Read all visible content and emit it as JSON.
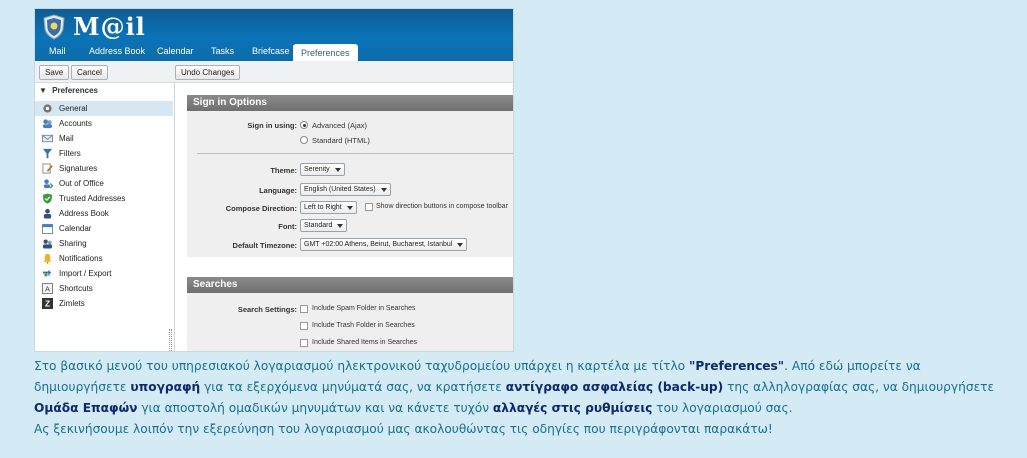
{
  "app": {
    "brand": "M@il",
    "tabs": [
      "Mail",
      "Address Book",
      "Calendar",
      "Tasks",
      "Briefcase",
      "Preferences"
    ],
    "active_tab": "Preferences"
  },
  "toolbar": {
    "save_label": "Save",
    "cancel_label": "Cancel",
    "undo_label": "Undo Changes"
  },
  "sidebar": {
    "header": "Preferences",
    "items": [
      {
        "label": "General",
        "icon": "gear-icon"
      },
      {
        "label": "Accounts",
        "icon": "accounts-icon"
      },
      {
        "label": "Mail",
        "icon": "mail-icon"
      },
      {
        "label": "Filters",
        "icon": "filter-icon"
      },
      {
        "label": "Signatures",
        "icon": "signature-icon"
      },
      {
        "label": "Out of Office",
        "icon": "out-of-office-icon"
      },
      {
        "label": "Trusted Addresses",
        "icon": "shield-check-icon"
      },
      {
        "label": "Address Book",
        "icon": "contact-icon"
      },
      {
        "label": "Calendar",
        "icon": "calendar-icon"
      },
      {
        "label": "Sharing",
        "icon": "sharing-icon"
      },
      {
        "label": "Notifications",
        "icon": "bell-icon"
      },
      {
        "label": "Import / Export",
        "icon": "import-export-icon"
      },
      {
        "label": "Shortcuts",
        "icon": "keyboard-icon"
      },
      {
        "label": "Zimlets",
        "icon": "zimlet-icon"
      }
    ]
  },
  "sign_in": {
    "title": "Sign in Options",
    "sign_in_label": "Sign in using:",
    "option_advanced": "Advanced (Ajax)",
    "option_standard": "Standard (HTML)",
    "theme_label": "Theme:",
    "theme_value": "Serenity",
    "language_label": "Language:",
    "language_value": "English (United States)",
    "compose_label": "Compose Direction:",
    "compose_value": "Left to Right",
    "compose_checkbox": "Show direction buttons in compose toolbar",
    "font_label": "Font:",
    "font_value": "Standard",
    "timezone_label": "Default Timezone:",
    "timezone_value": "GMT +02:00 Athens, Beirut, Bucharest, Istanbul"
  },
  "searches": {
    "title": "Searches",
    "settings_label": "Search Settings:",
    "opt1": "Include Spam Folder in Searches",
    "opt2": "Include Trash Folder in Searches",
    "opt3": "Include Shared Items in Searches"
  },
  "caption": {
    "p1": "Στο βασικό μενού του υπηρεσιακού λογαριασμού ηλεκτρονικού ταχυδρομείου υπάρχει η καρτέλα με τίτλο ",
    "b1": "\"Preferences\"",
    "p2": ". Από εδώ μπορείτε να δημιουργήσετε ",
    "b2": "υπογραφή",
    "p3": " για τα εξερχόμενα μηνύματά σας, να κρατήσετε ",
    "b3": "αντίγραφο ασφαλείας (back-up)",
    "p4": " της αλληλογραφίας σας, να δημιουργήσετε ",
    "b4": "Ομάδα Επαφών",
    "p5": " για αποστολή ομαδικών μηνυμάτων και να κάνετε τυχόν ",
    "b5": "αλλαγές στις ρυθμίσεις",
    "p6": " του λογαριασμού σας.",
    "line2": "Ας ξεκινήσουμε λοιπόν την εξερεύνηση του λογαριασμού μας ακολουθώντας τις οδηγίες που περιγράφονται παρακάτω!"
  }
}
